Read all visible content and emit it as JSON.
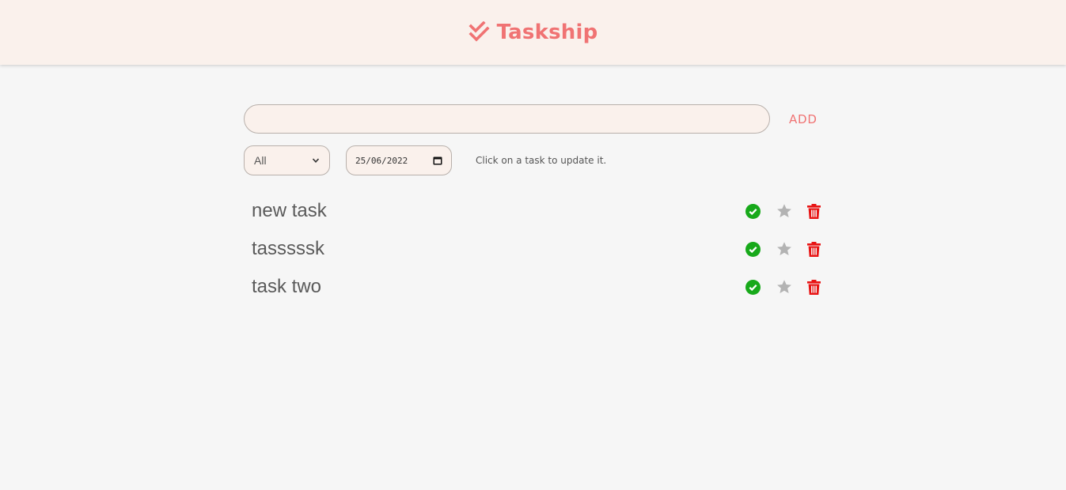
{
  "header": {
    "brand_name": "Taskship",
    "brand_icon": "double-check-icon",
    "brand_color": "#f07373",
    "background": "#faf1ec"
  },
  "add_task": {
    "input_value": "",
    "input_placeholder": "",
    "button_label": "ADD"
  },
  "filters": {
    "status_selected": "All",
    "date_value": "25/06/2022",
    "hint_text": "Click on a task to update it."
  },
  "tasks": [
    {
      "title": "new task"
    },
    {
      "title": "tasssssk"
    },
    {
      "title": "task two"
    }
  ],
  "colors": {
    "complete": "#17a91a",
    "star": "#b3b3b3",
    "delete": "#e81414"
  }
}
